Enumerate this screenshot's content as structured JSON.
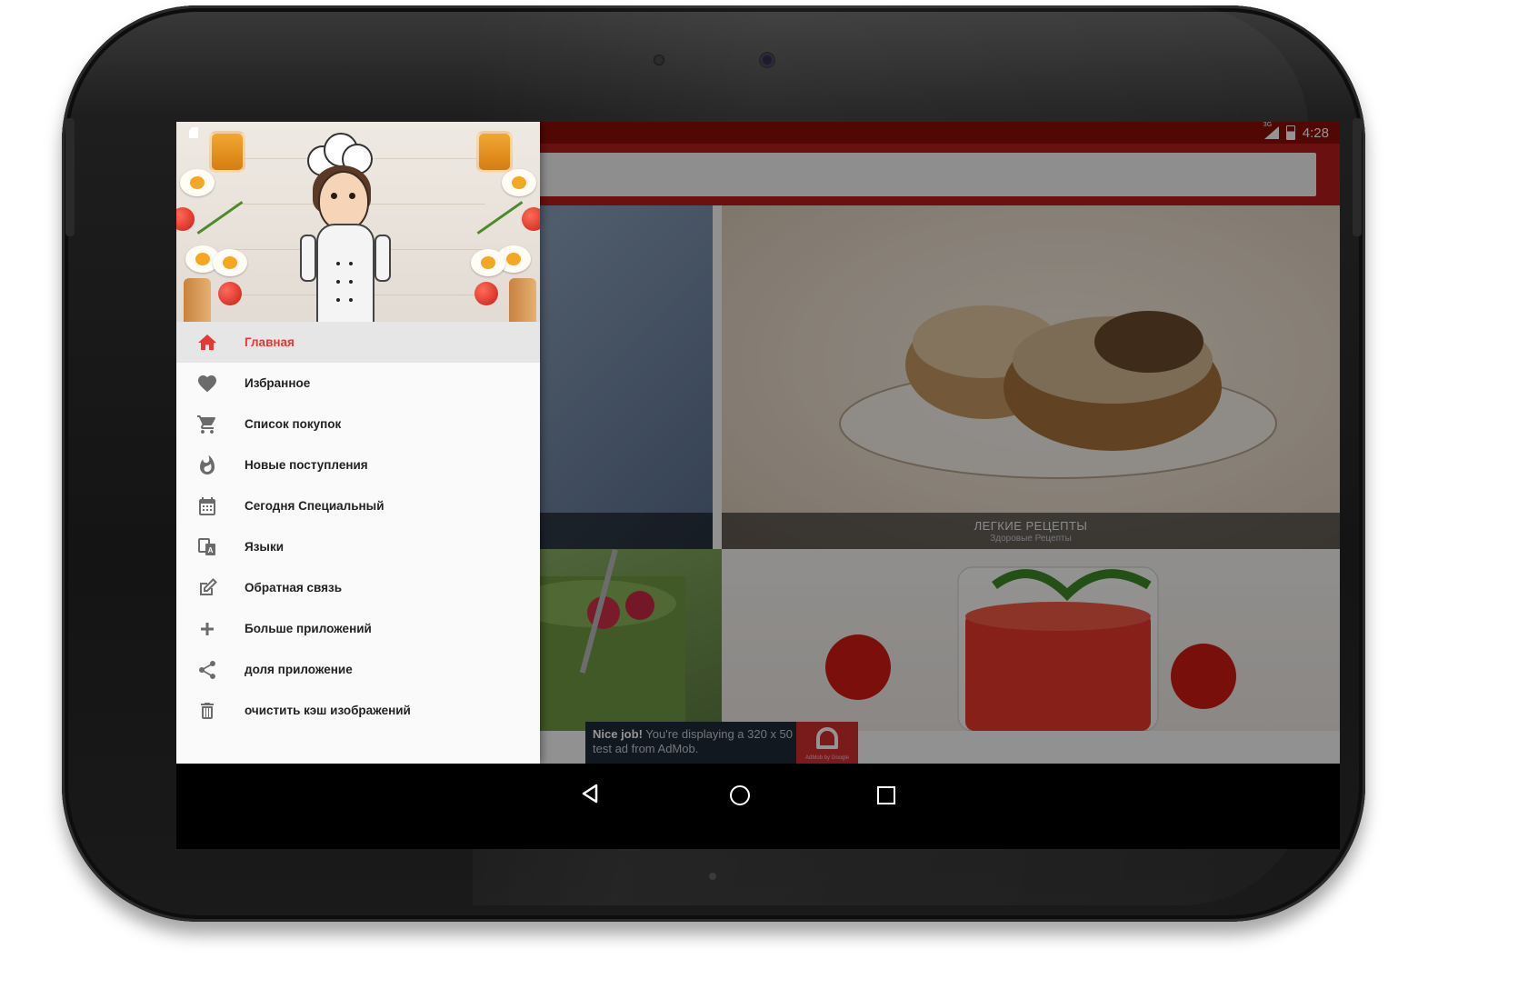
{
  "status_bar": {
    "network_label": "3G",
    "time": "4:28"
  },
  "toolbar": {
    "search_placeholder": ""
  },
  "content": {
    "tiles": [
      {
        "title": "",
        "subtitle": ""
      },
      {
        "title": "ЛЕГКИЕ РЕЦЕПТЫ",
        "subtitle": "Здоровые Рецепты"
      }
    ]
  },
  "ad": {
    "bold_text": "Nice job!",
    "text": " You're displaying a 320 x 50 test ad from AdMob.",
    "logo_caption": "AdMob by Google"
  },
  "drawer": {
    "items": [
      {
        "label": "Главная",
        "icon": "home-icon",
        "active": true
      },
      {
        "label": "Избранное",
        "icon": "heart-icon",
        "active": false
      },
      {
        "label": "Список покупок",
        "icon": "cart-icon",
        "active": false
      },
      {
        "label": "Новые поступления",
        "icon": "fire-icon",
        "active": false
      },
      {
        "label": "Сегодня Специальный",
        "icon": "calendar-icon",
        "active": false
      },
      {
        "label": "Языки",
        "icon": "translate-icon",
        "active": false
      },
      {
        "label": "Обратная связь",
        "icon": "edit-icon",
        "active": false
      },
      {
        "label": "Больше приложений",
        "icon": "plus-icon",
        "active": false
      },
      {
        "label": "доля приложение",
        "icon": "share-icon",
        "active": false
      },
      {
        "label": "очистить кэш изображений",
        "icon": "trash-icon",
        "active": false
      }
    ]
  },
  "colors": {
    "primary": "#b71c1c",
    "primary_dark": "#8c0f0a",
    "accent": "#e53935",
    "icon_gray": "#6b6b6b"
  }
}
